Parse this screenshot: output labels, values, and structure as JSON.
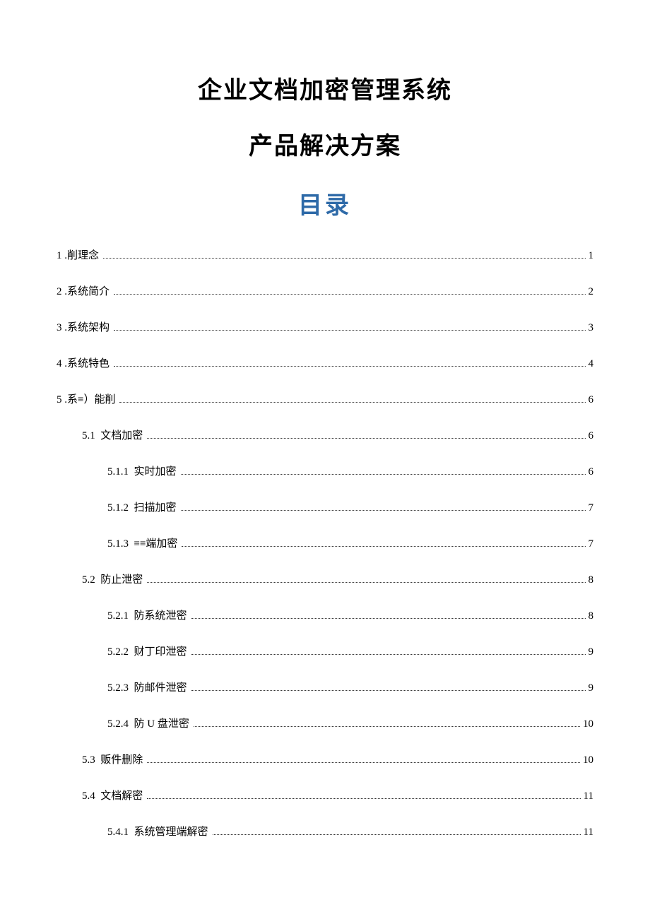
{
  "title": {
    "line1": "企业文档加密管理系统",
    "line2": "产品解决方案",
    "toc_header": "目录"
  },
  "toc": [
    {
      "level": 1,
      "num": "1 ",
      "label": ".削理念",
      "page": "1"
    },
    {
      "level": 1,
      "num": "2 ",
      "label": ".系统简介",
      "page": "2"
    },
    {
      "level": 1,
      "num": "3 ",
      "label": ".系统架构",
      "page": "3"
    },
    {
      "level": 1,
      "num": "4 ",
      "label": ".系统特色",
      "page": "4"
    },
    {
      "level": 1,
      "num": "5 ",
      "label": ".系≡）能削",
      "page": "6"
    },
    {
      "level": 2,
      "num": "5.1  ",
      "label": "文档加密",
      "page": "6"
    },
    {
      "level": 3,
      "num": "5.1.1  ",
      "label": "实时加密",
      "page": "6"
    },
    {
      "level": 3,
      "num": "5.1.2  ",
      "label": "扫描加密",
      "page": "7"
    },
    {
      "level": 3,
      "num": "5.1.3  ",
      "label": "≡≡端加密",
      "page": "7"
    },
    {
      "level": 2,
      "num": "5.2  ",
      "label": "防止泄密",
      "page": "8"
    },
    {
      "level": 3,
      "num": "5.2.1  ",
      "label": "防系统泄密",
      "page": "8"
    },
    {
      "level": 3,
      "num": "5.2.2  ",
      "label": "财丁印泄密",
      "page": "9"
    },
    {
      "level": 3,
      "num": "5.2.3  ",
      "label": "防邮件泄密",
      "page": "9"
    },
    {
      "level": 3,
      "num": "5.2.4  ",
      "label": "防 U 盘泄密",
      "page": "10"
    },
    {
      "level": 2,
      "num": "5.3  ",
      "label": "贩件删除",
      "page": "10"
    },
    {
      "level": 2,
      "num": "5.4  ",
      "label": "文档解密",
      "page": "11"
    },
    {
      "level": 3,
      "num": "5.4.1  ",
      "label": "系统管理端解密",
      "page": "11"
    }
  ]
}
